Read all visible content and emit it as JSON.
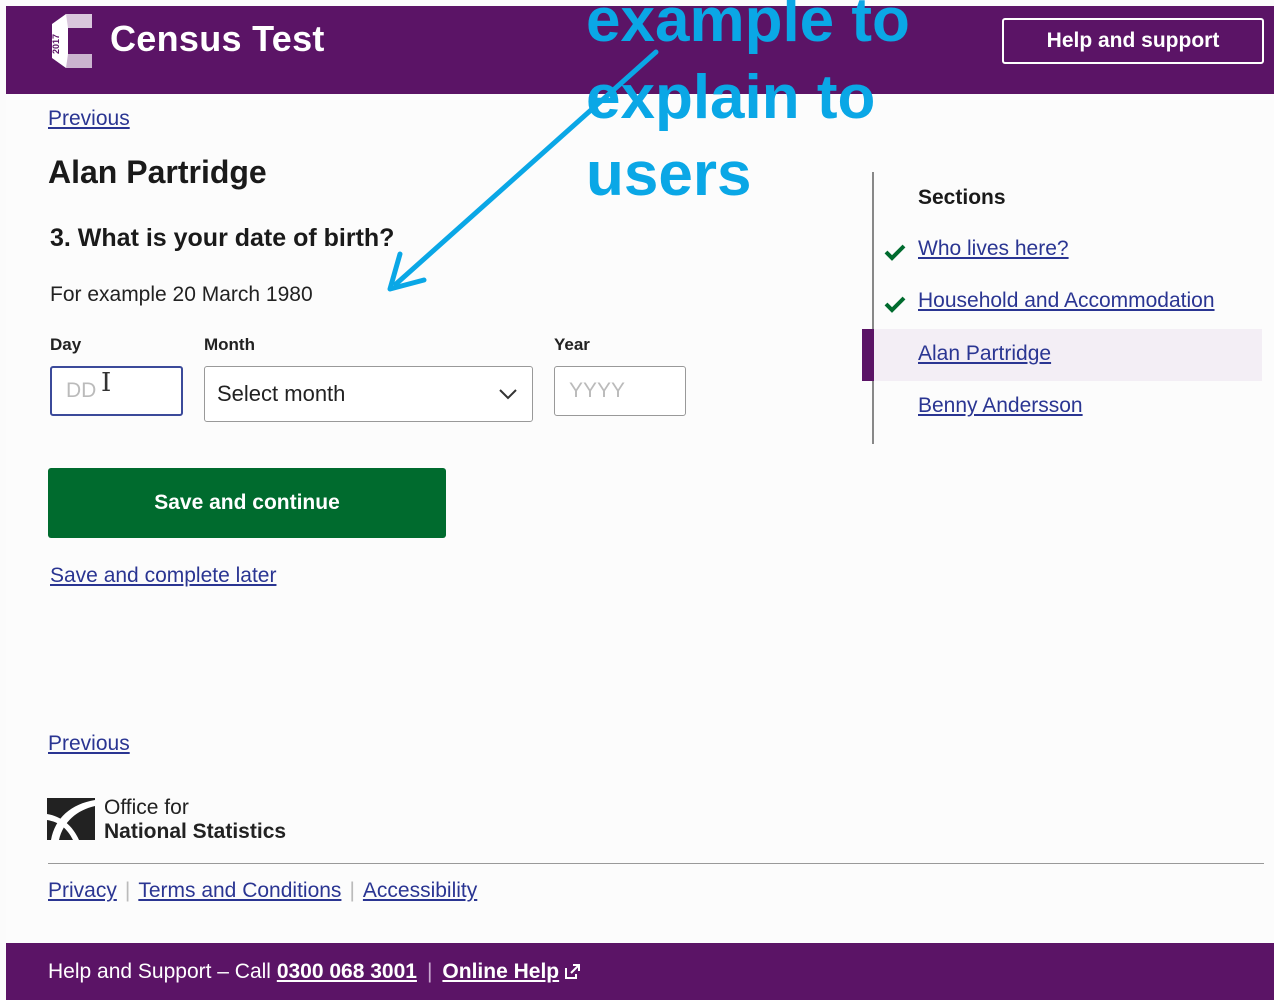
{
  "header": {
    "logo_year": "2017",
    "title": "Census Test",
    "help_button": "Help and support"
  },
  "annotation": {
    "line1": "example to",
    "line2": "explain to",
    "line3": "users"
  },
  "nav": {
    "previous_top": "Previous",
    "previous_bottom": "Previous"
  },
  "main": {
    "person_name": "Alan Partridge",
    "question": "3. What is your date of birth?",
    "hint": "For example 20 March 1980",
    "fields": {
      "day_label": "Day",
      "day_placeholder": "DD",
      "month_label": "Month",
      "month_value": "Select month",
      "year_label": "Year",
      "year_placeholder": "YYYY"
    },
    "save_button": "Save and continue",
    "save_later": "Save and complete later"
  },
  "sections": {
    "title": "Sections",
    "items": [
      {
        "label": "Who lives here?",
        "completed": true
      },
      {
        "label": "Household and Accommodation",
        "completed": true
      },
      {
        "label": "Alan Partridge",
        "current": true
      },
      {
        "label": "Benny Andersson"
      }
    ]
  },
  "footer": {
    "org_line1": "Office for",
    "org_line2": "National Statistics",
    "links": [
      "Privacy",
      "Terms and Conditions",
      "Accessibility"
    ],
    "bar_text": "Help and Support – Call ",
    "phone": "0300 068 3001",
    "online_help": "Online Help"
  },
  "colors": {
    "purple": "#5b1466",
    "green": "#006b2e",
    "link": "#2a3592",
    "annotation": "#0aa7e6"
  }
}
